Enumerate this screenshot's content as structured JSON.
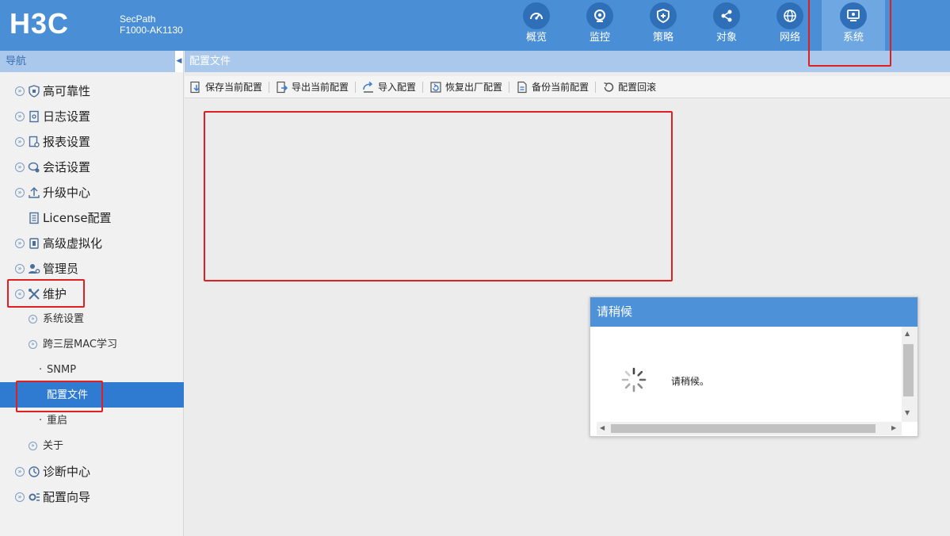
{
  "header": {
    "logo": "H3C",
    "product_line": "SecPath",
    "model": "F1000-AK1130",
    "nav": [
      {
        "label": "概览",
        "icon": "gauge-icon"
      },
      {
        "label": "监控",
        "icon": "monitor-camera-icon"
      },
      {
        "label": "策略",
        "icon": "shield-plus-icon"
      },
      {
        "label": "对象",
        "icon": "share-nodes-icon"
      },
      {
        "label": "网络",
        "icon": "globe-icon"
      },
      {
        "label": "系统",
        "icon": "system-screen-icon",
        "active": true
      }
    ]
  },
  "sidebar": {
    "title": "导航",
    "items": [
      {
        "label": "高可靠性",
        "icon": "shield-icon"
      },
      {
        "label": "日志设置",
        "icon": "log-icon"
      },
      {
        "label": "报表设置",
        "icon": "report-icon"
      },
      {
        "label": "会话设置",
        "icon": "session-icon"
      },
      {
        "label": "升级中心",
        "icon": "upgrade-icon"
      },
      {
        "label": "License配置",
        "icon": "license-icon"
      },
      {
        "label": "高级虚拟化",
        "icon": "virtualization-icon"
      },
      {
        "label": "管理员",
        "icon": "admin-icon"
      },
      {
        "label": "维护",
        "icon": "tools-icon",
        "expanded": true
      }
    ],
    "maintenance_children": [
      {
        "label": "系统设置",
        "has_children": true
      },
      {
        "label": "跨三层MAC学习",
        "has_children": true
      },
      {
        "label": "SNMP"
      },
      {
        "label": "配置文件",
        "selected": true
      },
      {
        "label": "重启"
      },
      {
        "label": "关于",
        "has_children": true
      }
    ],
    "bottom_items": [
      {
        "label": "诊断中心",
        "icon": "diagnosis-icon"
      },
      {
        "label": "配置向导",
        "icon": "wizard-icon"
      }
    ]
  },
  "main": {
    "title": "配置文件",
    "toolbar": [
      {
        "label": "保存当前配置",
        "icon": "save-config-icon"
      },
      {
        "label": "导出当前配置",
        "icon": "export-config-icon"
      },
      {
        "label": "导入配置",
        "icon": "import-config-icon"
      },
      {
        "label": "恢复出厂配置",
        "icon": "factory-reset-icon"
      },
      {
        "label": "备份当前配置",
        "icon": "backup-config-icon"
      },
      {
        "label": "配置回滚",
        "icon": "rollback-icon"
      }
    ]
  },
  "dialog": {
    "title": "请稍候",
    "message": "请稍候。"
  },
  "colors": {
    "header_bg": "#4a8fd6",
    "selected_bg": "#2f7bd1",
    "highlight_red": "#e02020"
  }
}
